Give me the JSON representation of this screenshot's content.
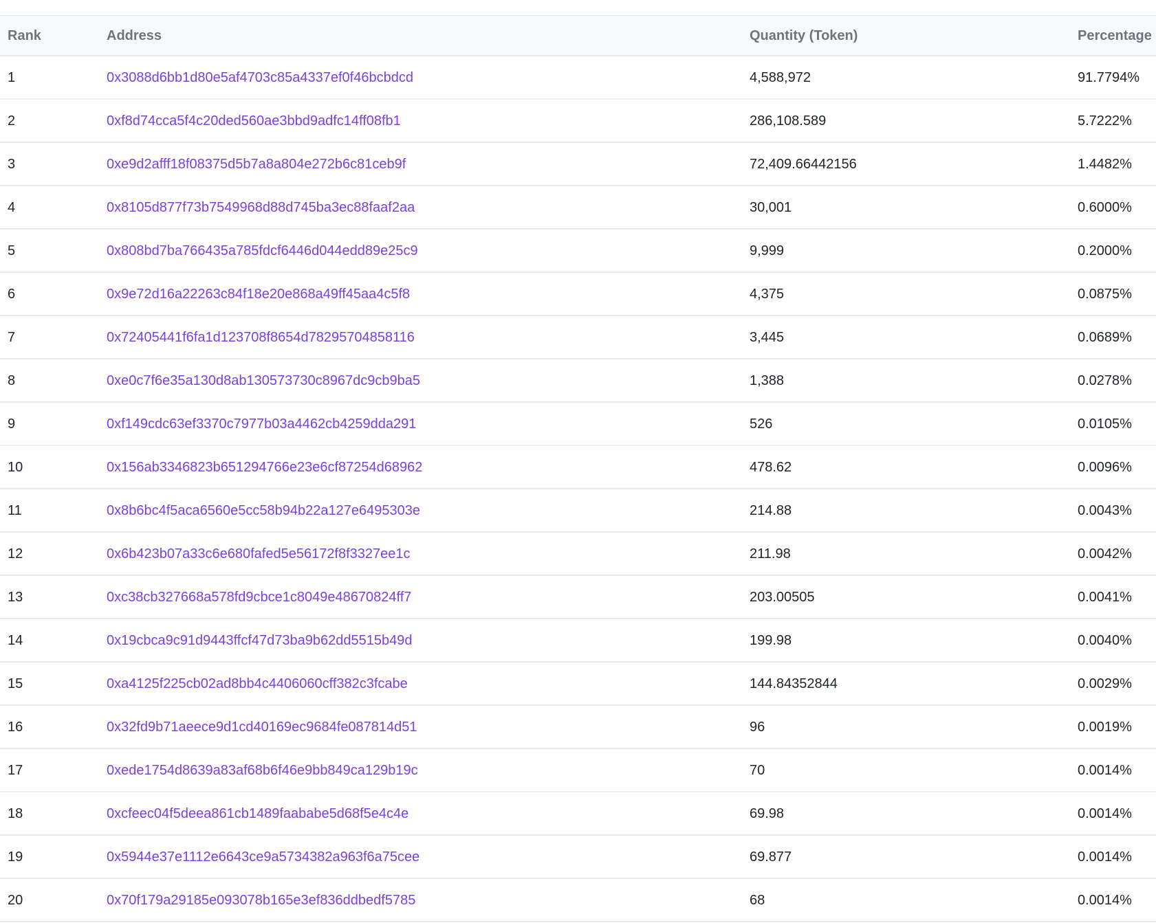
{
  "table": {
    "headers": {
      "rank": "Rank",
      "address": "Address",
      "quantity": "Quantity (Token)",
      "percentage": "Percentage"
    },
    "rows": [
      {
        "rank": "1",
        "address": "0x3088d6bb1d80e5af4703c85a4337ef0f46bcbdcd",
        "quantity": "4,588,972",
        "percentage": "91.7794%"
      },
      {
        "rank": "2",
        "address": "0xf8d74cca5f4c20ded560ae3bbd9adfc14ff08fb1",
        "quantity": "286,108.589",
        "percentage": "5.7222%"
      },
      {
        "rank": "3",
        "address": "0xe9d2afff18f08375d5b7a8a804e272b6c81ceb9f",
        "quantity": "72,409.66442156",
        "percentage": "1.4482%"
      },
      {
        "rank": "4",
        "address": "0x8105d877f73b7549968d88d745ba3ec88faaf2aa",
        "quantity": "30,001",
        "percentage": "0.6000%"
      },
      {
        "rank": "5",
        "address": "0x808bd7ba766435a785fdcf6446d044edd89e25c9",
        "quantity": "9,999",
        "percentage": "0.2000%"
      },
      {
        "rank": "6",
        "address": "0x9e72d16a22263c84f18e20e868a49ff45aa4c5f8",
        "quantity": "4,375",
        "percentage": "0.0875%"
      },
      {
        "rank": "7",
        "address": "0x72405441f6fa1d123708f8654d78295704858116",
        "quantity": "3,445",
        "percentage": "0.0689%"
      },
      {
        "rank": "8",
        "address": "0xe0c7f6e35a130d8ab130573730c8967dc9cb9ba5",
        "quantity": "1,388",
        "percentage": "0.0278%"
      },
      {
        "rank": "9",
        "address": "0xf149cdc63ef3370c7977b03a4462cb4259dda291",
        "quantity": "526",
        "percentage": "0.0105%"
      },
      {
        "rank": "10",
        "address": "0x156ab3346823b651294766e23e6cf87254d68962",
        "quantity": "478.62",
        "percentage": "0.0096%"
      },
      {
        "rank": "11",
        "address": "0x8b6bc4f5aca6560e5cc58b94b22a127e6495303e",
        "quantity": "214.88",
        "percentage": "0.0043%"
      },
      {
        "rank": "12",
        "address": "0x6b423b07a33c6e680fafed5e56172f8f3327ee1c",
        "quantity": "211.98",
        "percentage": "0.0042%"
      },
      {
        "rank": "13",
        "address": "0xc38cb327668a578fd9cbce1c8049e48670824ff7",
        "quantity": "203.00505",
        "percentage": "0.0041%"
      },
      {
        "rank": "14",
        "address": "0x19cbca9c91d9443ffcf47d73ba9b62dd5515b49d",
        "quantity": "199.98",
        "percentage": "0.0040%"
      },
      {
        "rank": "15",
        "address": "0xa4125f225cb02ad8bb4c4406060cff382c3fcabe",
        "quantity": "144.84352844",
        "percentage": "0.0029%"
      },
      {
        "rank": "16",
        "address": "0x32fd9b71aeece9d1cd40169ec9684fe087814d51",
        "quantity": "96",
        "percentage": "0.0019%"
      },
      {
        "rank": "17",
        "address": "0xede1754d8639a83af68b6f46e9bb849ca129b19c",
        "quantity": "70",
        "percentage": "0.0014%"
      },
      {
        "rank": "18",
        "address": "0xcfeec04f5deea861cb1489faababe5d68f5e4c4e",
        "quantity": "69.98",
        "percentage": "0.0014%"
      },
      {
        "rank": "19",
        "address": "0x5944e37e1112e6643ce9a5734382a963f6a75cee",
        "quantity": "69.877",
        "percentage": "0.0014%"
      },
      {
        "rank": "20",
        "address": "0x70f179a29185e093078b165e3ef836ddbedf5785",
        "quantity": "68",
        "percentage": "0.0014%"
      }
    ]
  },
  "colors": {
    "link": "#7b3fe4",
    "header_text": "#6c757d",
    "header_bg": "#f8f9fa",
    "row_border": "#e7eaf3"
  }
}
